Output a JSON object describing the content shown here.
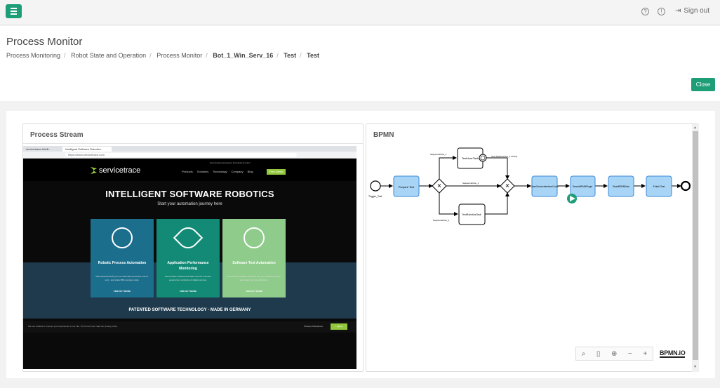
{
  "topbar": {
    "help_icon": "?",
    "info_icon": "!",
    "signout_label": "Sign out"
  },
  "header": {
    "title": "Process Monitor",
    "breadcrumb": [
      "Process Monitoring",
      "Robot State and Operation",
      "Process Monitor",
      "Bot_1_Win_Serv_16",
      "Test",
      "Test"
    ],
    "close_label": "Close"
  },
  "process_stream": {
    "title": "Process Stream",
    "screenshot": {
      "tab1": "servicetrace-Intelli...",
      "tab2": "Intelligent Software Robotics",
      "url": "https://www.servicetrace.com",
      "logo": "servicetrace",
      "top_menu": "Servicetrace   Ecosystem   Download   Contact",
      "menu": [
        "Products",
        "Solutions",
        "Technology",
        "Company",
        "Blog"
      ],
      "demo": "Free Demo",
      "hero_title": "INTELLIGENT SOFTWARE ROBOTICS",
      "hero_sub": "Start your automation journey here",
      "cards": [
        {
          "title": "Robotic Process Automation",
          "desc": "With Servicetrace® you can automate processes end-to-end – and scale RPA company-wide.",
          "link": "FIND OUT MORE",
          "color": "#1b6e8c"
        },
        {
          "title": "Application Performance Monitoring",
          "desc": "Servicetrace software bots take over the end-user experience monitoring of digital services.",
          "link": "FIND OUT MORE",
          "color": "#138a76"
        },
        {
          "title": "Software Test Automation",
          "desc": "Servicetrace Software test bots test your software quickly, accurately and cost-effectively.",
          "link": "FIND OUT MORE",
          "color": "#8fcb8a"
        }
      ],
      "patent": "PATENTED SOFTWARE TECHNOLOGY - MADE IN GERMANY",
      "cookie_text": "We use cookies to improve your experience on our site. To find out more read our privacy policy.",
      "cookie_pref": "Privacy Preferences",
      "cookie_accept": "I agree"
    }
  },
  "bpmn": {
    "title": "BPMN",
    "nodes": {
      "start_label": "Trigger_Test",
      "task1": "Prepare Test",
      "user_task": "TestUserTask",
      "script_task": "TestRoboticsTask",
      "task_open": "OpenServiceInterfaceComp",
      "task_search": "SearchBPMNPlugin",
      "task_read": "ReadBPMNData",
      "task_finish": "Finish Test"
    },
    "flows": {
      "sf1": "SequenceFlow_1",
      "sf2": "SequenceFlow_2",
      "sf_mid": "SequenceFlow_1",
      "boundary": "UserTaskTimeOut_1 activity"
    },
    "zoom_icons": [
      "search-icon",
      "map-icon",
      "locate-icon",
      "zoom-out-icon",
      "zoom-in-icon"
    ],
    "brand": "BPMN.iO"
  }
}
